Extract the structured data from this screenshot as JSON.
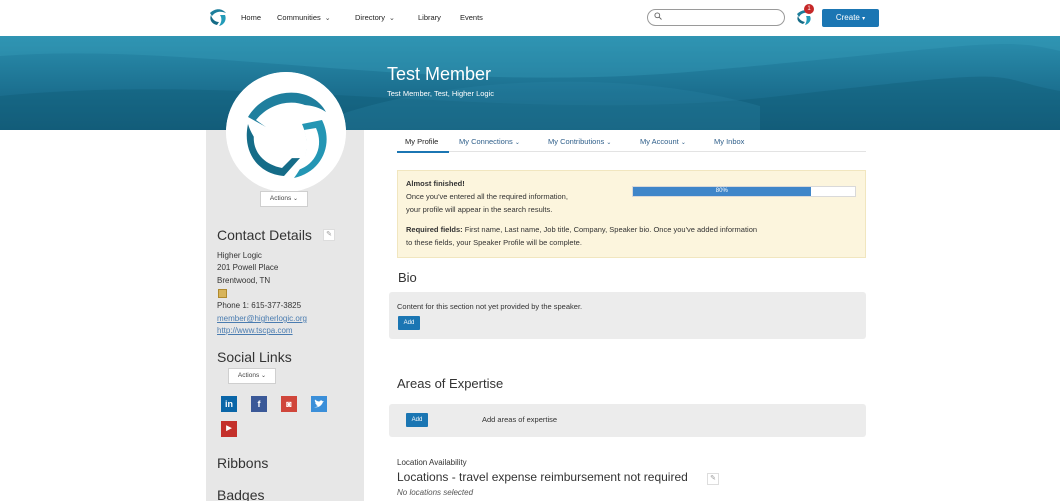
{
  "nav": {
    "items": [
      {
        "label": "Home",
        "has_menu": false
      },
      {
        "label": "Communities",
        "has_menu": true
      },
      {
        "label": "Directory",
        "has_menu": true
      },
      {
        "label": "Library",
        "has_menu": false
      },
      {
        "label": "Events",
        "has_menu": false
      }
    ],
    "search_placeholder": "",
    "notification_count": "1",
    "create_label": "Create"
  },
  "profile": {
    "name": "Test Member",
    "subtitle": "Test Member, Test, Higher Logic"
  },
  "sidebar": {
    "actions_label": "Actions",
    "contact_heading": "Contact Details",
    "company": "Higher Logic",
    "address1": "201 Powell Place",
    "address2": "Brentwood, TN",
    "phone": "Phone 1: 615-377-3825",
    "email": "member@higherlogic.org",
    "website": "http://www.tscpa.com",
    "social_heading": "Social Links",
    "social_actions_label": "Actions",
    "social_icons": [
      "linkedin-icon",
      "facebook-icon",
      "instagram-icon",
      "twitter-icon",
      "youtube-icon"
    ],
    "ribbons_heading": "Ribbons",
    "badges_heading": "Badges"
  },
  "tabs": [
    {
      "label": "My Profile",
      "active": true
    },
    {
      "label": "My Connections",
      "has_menu": true
    },
    {
      "label": "My Contributions",
      "has_menu": true
    },
    {
      "label": "My Account",
      "has_menu": true
    },
    {
      "label": "My Inbox",
      "has_menu": false
    }
  ],
  "alert": {
    "title": "Almost finished!",
    "line1": "Once you've entered all the required information,",
    "line2": "your profile will appear in the search results.",
    "required_label": "Required fields:",
    "required_text": " First name, Last name, Job title, Company, Speaker bio. Once you've added information",
    "required_text2": "to these fields, your Speaker Profile will be complete.",
    "progress_label": "80%",
    "progress_value": 0.8
  },
  "bio": {
    "heading": "Bio",
    "text": "Content for this section not yet provided by the speaker.",
    "add_label": "Add"
  },
  "expertise": {
    "heading": "Areas of Expertise",
    "add_label": "Add",
    "text": "Add areas of expertise"
  },
  "location": {
    "label": "Location Availability",
    "title": "Locations - travel expense reimbursement not required",
    "note": "No locations selected"
  },
  "colors": {
    "brand_blue": "#1b76b3",
    "banner_teal": "#1b6f8f",
    "alert_bg": "#fcf5dd",
    "progress_fill": "#3f86c9"
  }
}
